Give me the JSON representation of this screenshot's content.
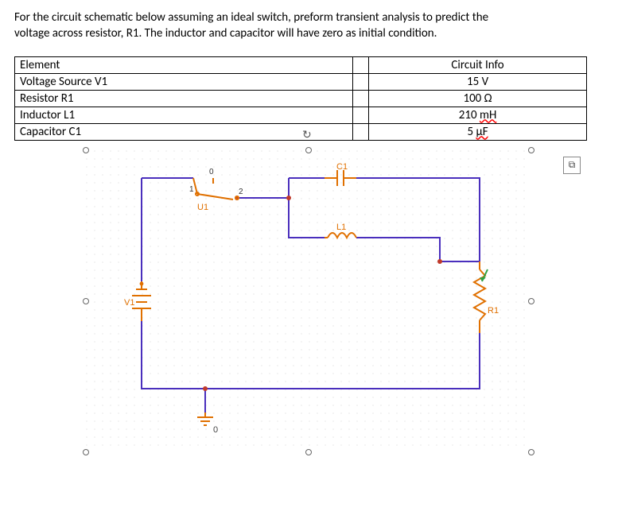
{
  "problem": {
    "line1": "For the circuit schematic below assuming an ideal switch, preform transient analysis to predict the",
    "line2": "voltage across resistor, R1. The inductor and capacitor will have zero as initial condition."
  },
  "table": {
    "header_left": "Element",
    "header_right": "Circuit Info",
    "rows": [
      {
        "label": "Voltage Source V1",
        "value": "15 V"
      },
      {
        "label": "Resistor R1",
        "value_prefix": "100 ",
        "value_unit": "Ω"
      },
      {
        "label": "Inductor L1",
        "value_prefix": "210 ",
        "value_unit": "mH",
        "squiggle": true
      },
      {
        "label": "Capacitor C1",
        "value_prefix": "5 ",
        "value_unit": "μF",
        "squiggle": true
      }
    ]
  },
  "schematic": {
    "labels": {
      "V1": "V1",
      "R1": "R1",
      "L1": "L1",
      "C1": "C1",
      "U1": "U1",
      "sw0": "0",
      "sw1": "1",
      "sw2": "2",
      "gnd0": "0"
    }
  }
}
